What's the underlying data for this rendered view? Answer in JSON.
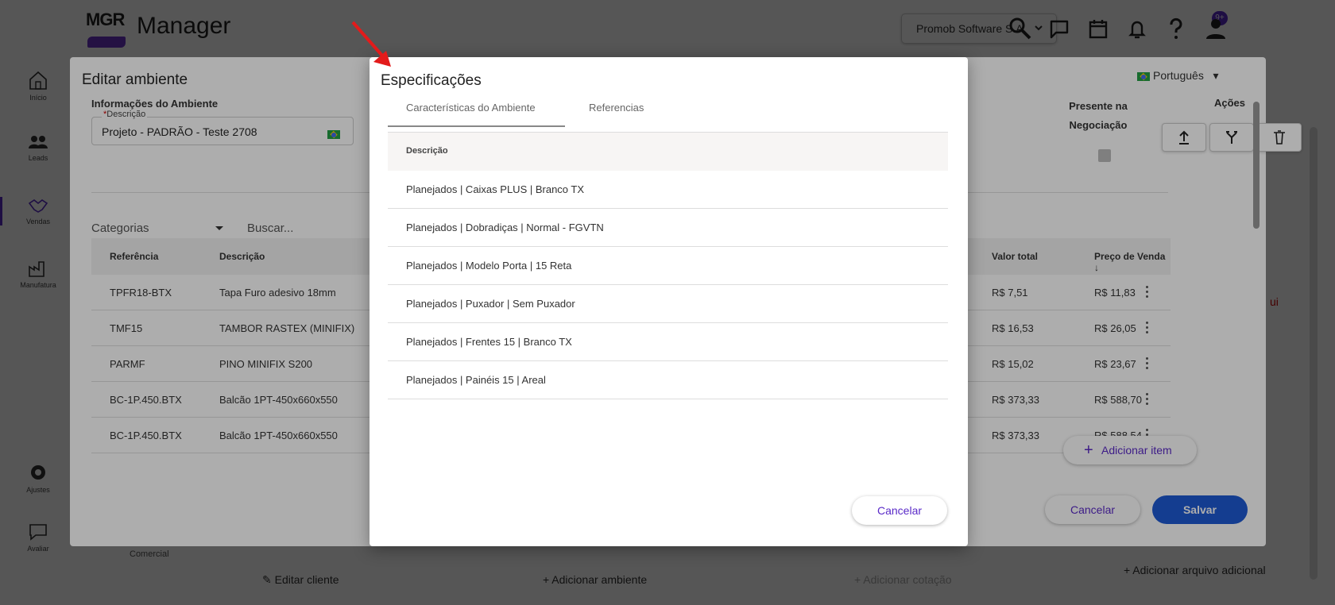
{
  "app": {
    "logo_text": "MGR",
    "brand": "Manager",
    "company": "Promob Software S.A.",
    "notifications_badge": "9+"
  },
  "sidebar": {
    "items": [
      {
        "label": "Início",
        "icon": "home-icon"
      },
      {
        "label": "Leads",
        "icon": "people-icon"
      },
      {
        "label": "Vendas",
        "icon": "handshake-icon"
      },
      {
        "label": "Manufatura",
        "icon": "factory-icon"
      },
      {
        "label": "Ajustes",
        "icon": "gear-icon"
      },
      {
        "label": "Avaliar",
        "icon": "chat-icon"
      }
    ]
  },
  "background": {
    "comercial_label": "Comercial",
    "edit_client": "Editar cliente",
    "add_environment": "Adicionar ambiente",
    "add_quote": "Adicionar cotação",
    "add_file": "Adicionar arquivo adicional",
    "partial_text": "ui"
  },
  "edit_modal": {
    "title": "Editar ambiente",
    "section": "Informações do Ambiente",
    "desc_label": "Descrição",
    "desc_required_mark": "*",
    "desc_value": "Projeto - PADRÃO - Teste 2708",
    "language": "Português",
    "presente_label": "Presente na Negociação",
    "acoes_label": "Ações",
    "categories_placeholder": "Categorias",
    "search_placeholder": "Buscar...",
    "columns": {
      "ref": "Referência",
      "desc": "Descrição",
      "total": "Valor total",
      "price": "Preço de Venda"
    },
    "rows": [
      {
        "ref": "TPFR18-BTX",
        "desc": "Tapa Furo adesivo 18mm",
        "total": "R$ 7,51",
        "price": "R$ 11,83"
      },
      {
        "ref": "TMF15",
        "desc": "TAMBOR RASTEX (MINIFIX)",
        "total": "R$ 16,53",
        "price": "R$ 26,05"
      },
      {
        "ref": "PARMF",
        "desc": "PINO MINIFIX S200",
        "total": "R$ 15,02",
        "price": "R$ 23,67"
      },
      {
        "ref": "BC-1P.450.BTX",
        "desc": "Balcão 1PT-450x660x550",
        "total": "R$ 373,33",
        "price": "R$ 588,70"
      },
      {
        "ref": "BC-1P.450.BTX",
        "desc": "Balcão 1PT-450x660x550",
        "total": "R$ 373,33",
        "price": "R$ 588,54"
      }
    ],
    "add_item": "Adicionar item",
    "cancel": "Cancelar",
    "save": "Salvar"
  },
  "spec_modal": {
    "title": "Especificações",
    "tabs": [
      "Características do Ambiente",
      "Referencias"
    ],
    "column": "Descrição",
    "rows": [
      "Planejados | Caixas PLUS | Branco TX",
      "Planejados | Dobradiças | Normal - FGVTN",
      "Planejados | Modelo Porta | 15 Reta",
      "Planejados | Puxador | Sem Puxador",
      "Planejados | Frentes 15 | Branco TX",
      "Planejados | Painéis 15 | Areal"
    ],
    "cancel": "Cancelar"
  },
  "colors": {
    "accent": "#5a2ac8",
    "primary_button": "#1e5bd4",
    "annotation_arrow": "#e31b1b"
  }
}
